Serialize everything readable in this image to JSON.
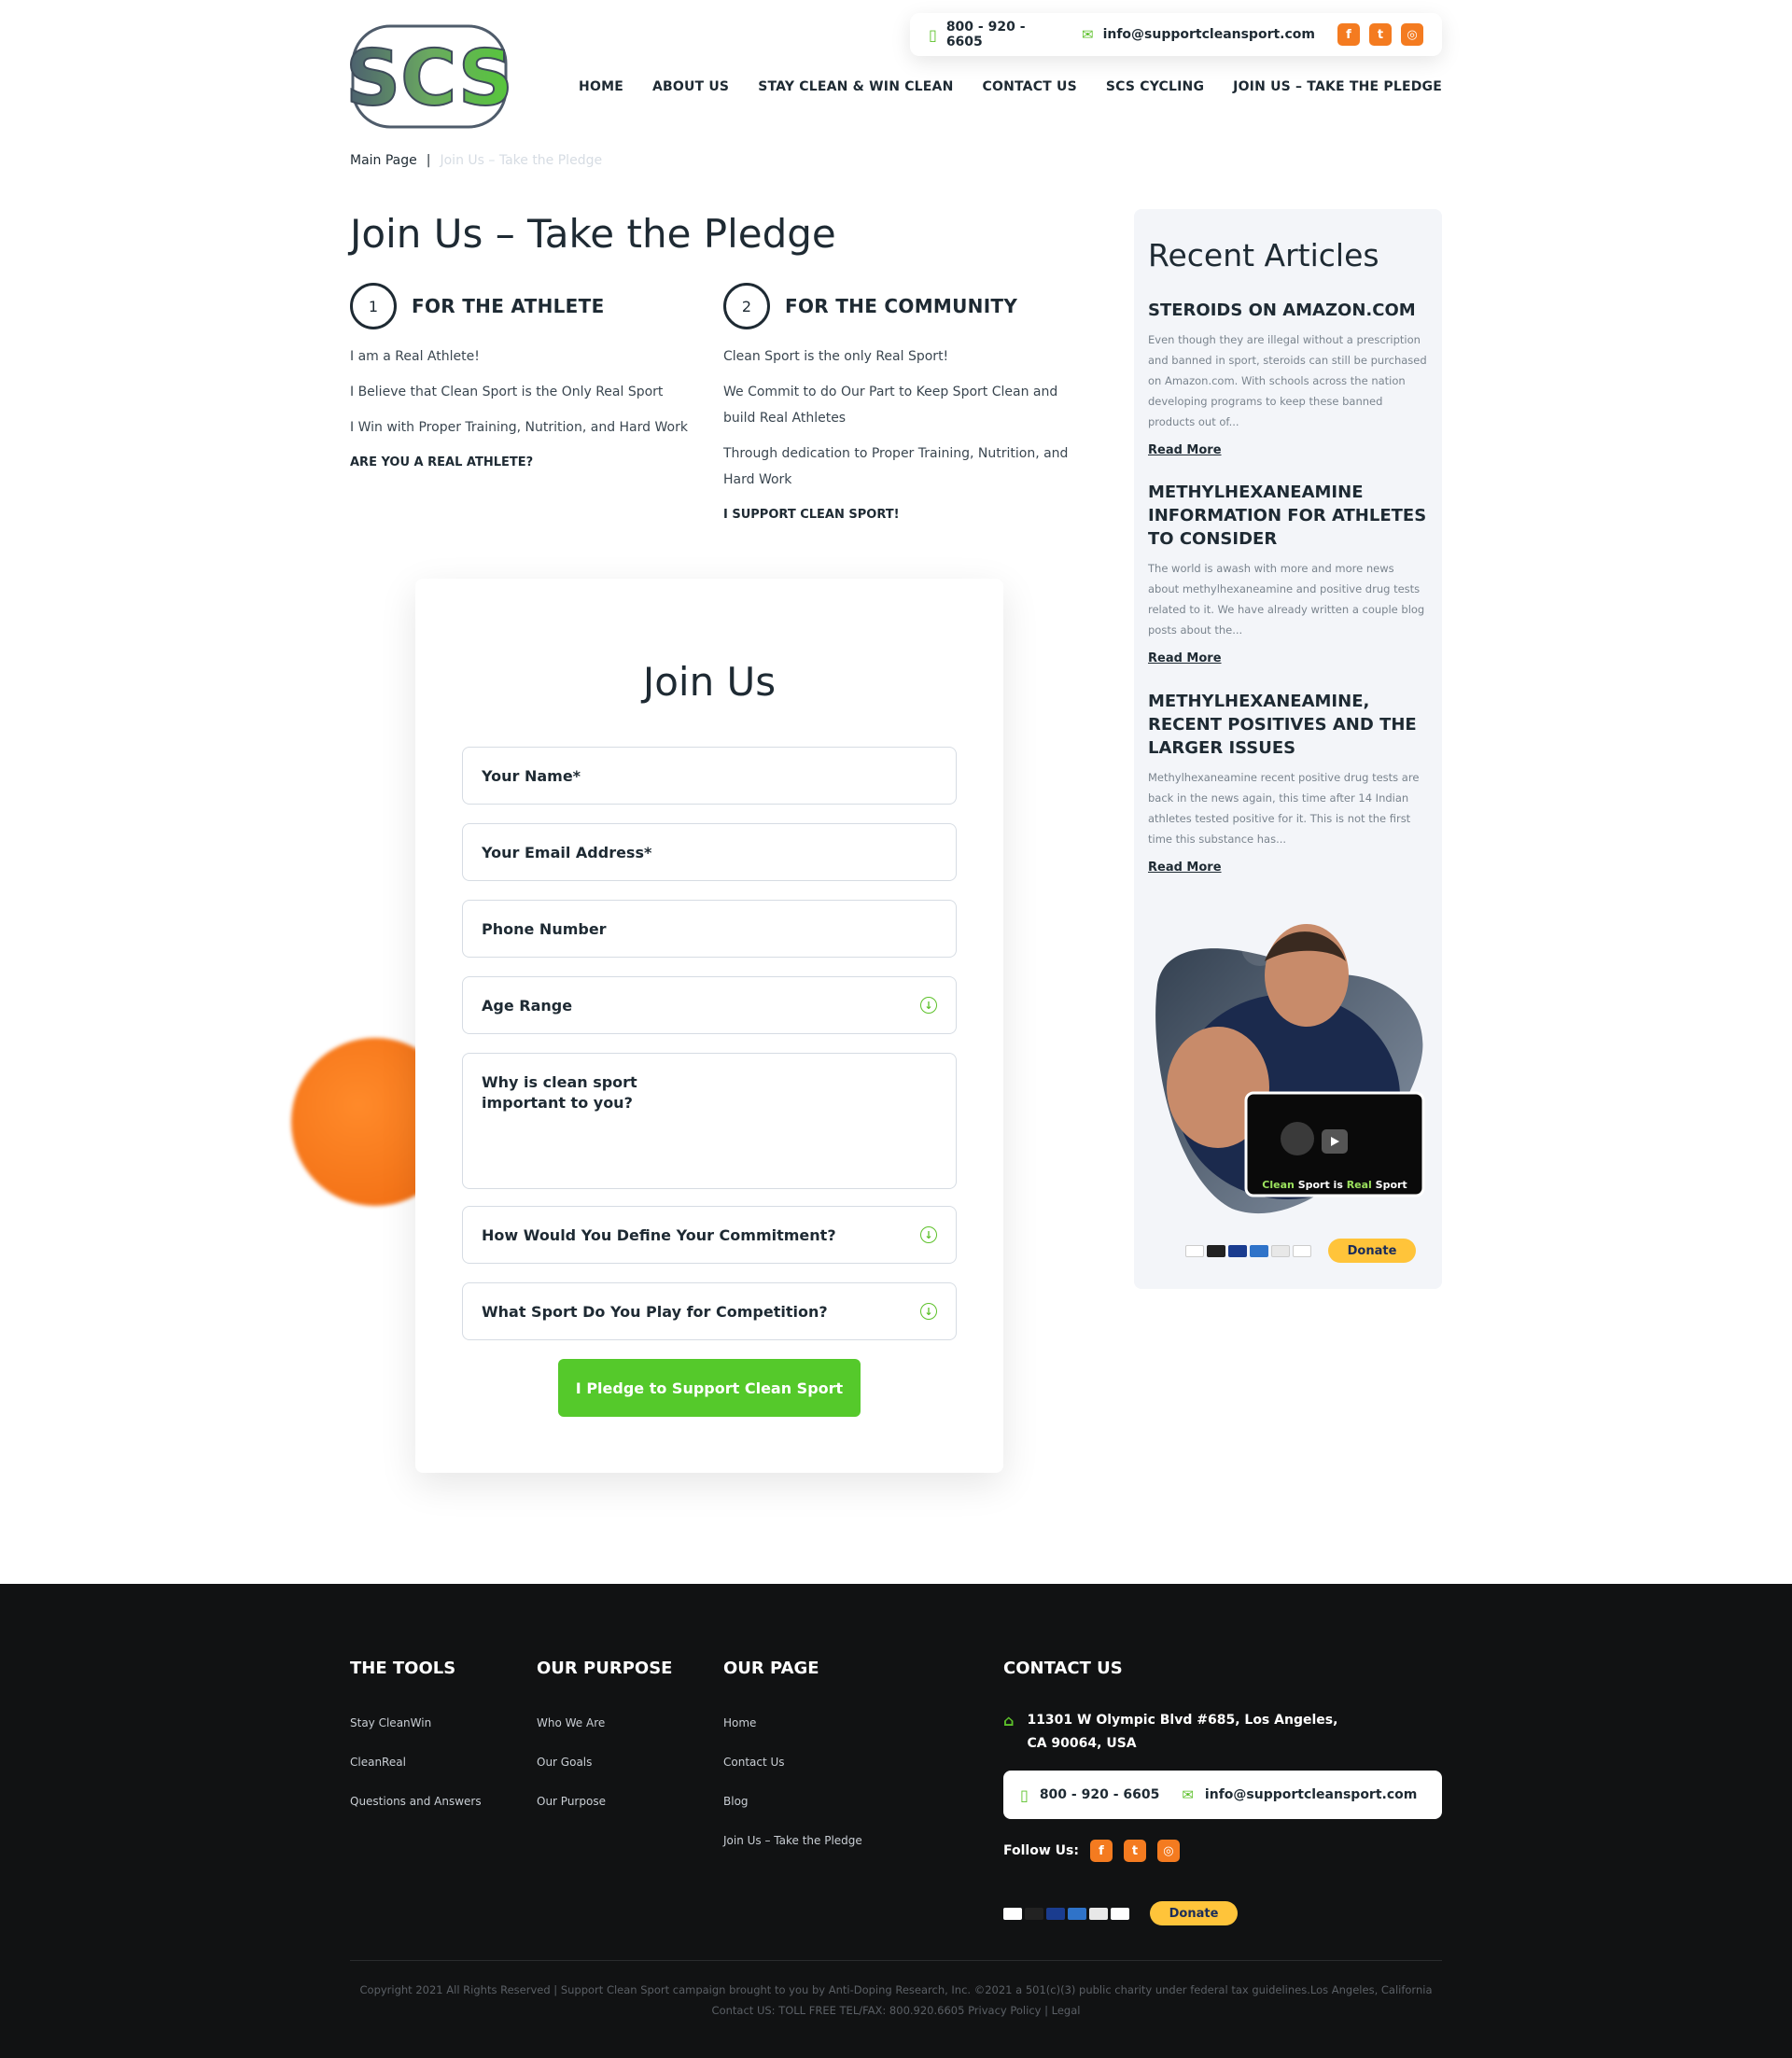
{
  "header": {
    "phone": "800 - 920 - 6605",
    "email": "info@supportcleansport.com",
    "logo_text": "SCS",
    "nav": [
      "HOME",
      "ABOUT US",
      "STAY CLEAN & WIN CLEAN",
      "CONTACT US",
      "SCS CYCLING",
      "JOIN US – TAKE THE PLEDGE"
    ]
  },
  "breadcrumb": {
    "home": "Main Page",
    "separator": "|",
    "current": "Join Us – Take the Pledge"
  },
  "page_title": "Join Us – Take the Pledge",
  "athlete": {
    "number": "1",
    "title": "FOR THE ATHLETE",
    "lines": [
      "I am a Real Athlete!",
      "I Believe that Clean Sport is the Only Real Sport",
      "I Win with Proper Training, Nutrition, and Hard Work"
    ],
    "closing": "ARE YOU A REAL ATHLETE?"
  },
  "community": {
    "number": "2",
    "title": "FOR THE COMMUNITY",
    "lines": [
      "Clean Sport is the only Real Sport!",
      "We Commit to do Our Part to Keep Sport Clean and build Real Athletes",
      "Through dedication to Proper Training, Nutrition, and Hard Work"
    ],
    "closing": "I SUPPORT CLEAN SPORT!"
  },
  "form": {
    "title": "Join Us",
    "name_placeholder": "Your Name*",
    "email_placeholder": "Your Email Address*",
    "phone_placeholder": "Phone Number",
    "age_label": "Age Range",
    "why_placeholder": "Why is clean sport important to you?",
    "commitment_label": "How Would You Define Your Commitment?",
    "sport_label": "What Sport Do You Play for Competition?",
    "submit_label": "I Pledge to Support Clean Sport"
  },
  "sidebar": {
    "title": "Recent Articles",
    "articles": [
      {
        "title": "STEROIDS ON AMAZON.COM",
        "excerpt": "Even though they are illegal without a prescription and banned in sport, steroids can still be purchased on Amazon.com. With schools across the nation developing programs to keep these banned products out of...",
        "link": "Read More"
      },
      {
        "title": "METHYLHEXANEAMINE INFORMATION FOR ATHLETES TO CONSIDER",
        "excerpt": "The world is awash with more and more news about methylhexaneamine and positive drug tests related to it.  We have already written a couple blog posts about the...",
        "link": "Read More"
      },
      {
        "title": "METHYLHEXANEAMINE, RECENT POSITIVES AND THE LARGER ISSUES",
        "excerpt": "Methylhexaneamine recent positive drug tests are back in the news again, this time after 14 Indian athletes tested positive for it. This is not the first time this substance has...",
        "link": "Read More"
      }
    ],
    "video_caption_a": "Clean",
    "video_caption_b": " Sport is ",
    "video_caption_c": "Real",
    "video_caption_d": " Sport",
    "donate": "Donate"
  },
  "footer": {
    "tools_title": "THE TOOLS",
    "tools": [
      "Stay CleanWin",
      "CleanReal",
      "Questions and Answers"
    ],
    "purpose_title": "OUR PURPOSE",
    "purpose": [
      "Who We Are",
      "Our Goals",
      "Our Purpose"
    ],
    "page_title": "OUR PAGE",
    "pages": [
      "Home",
      "Contact Us",
      "Blog",
      "Join Us – Take the Pledge"
    ],
    "contact_title": "CONTACT US",
    "address_line1": "11301 W Olympic Blvd #685, Los Angeles,",
    "address_line2": "CA 90064, USA",
    "phone": "800 - 920 - 6605",
    "email": "info@supportcleansport.com",
    "follow": "Follow Us:",
    "donate": "Donate",
    "copyright": "Copyright 2021 All Rights Reserved | Support Clean Sport campaign brought to you by Anti-Doping Research, Inc. ©2021 a 501(c)(3) public charity under federal tax guidelines.Los Angeles, California Contact US: TOLL FREE TEL/FAX: 800.920.6605 Privacy Policy | Legal"
  },
  "colors": {
    "accent_green": "#55c92b",
    "accent_orange": "#f47b20",
    "footer_bg": "#111213",
    "sidebar_bg": "#f3f5f9",
    "donate_yellow": "#ffc43a"
  }
}
